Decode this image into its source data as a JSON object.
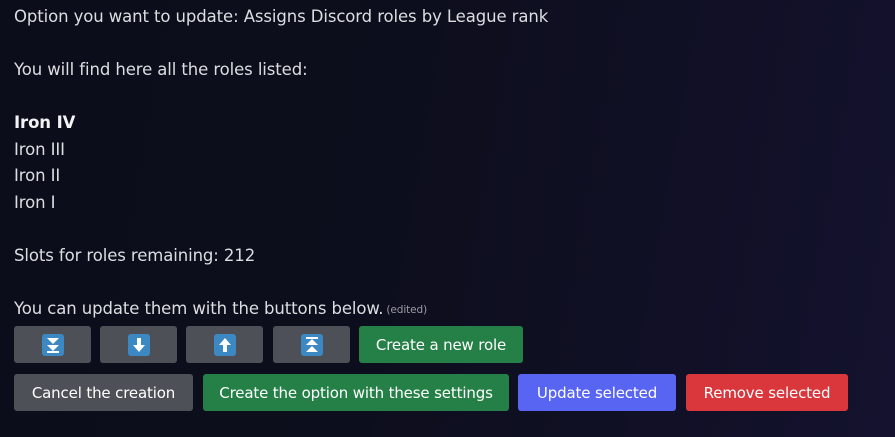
{
  "message": {
    "option_line": "Option you want to update: Assigns Discord roles by League rank",
    "intro_line": "You will find here all the roles listed:",
    "roles": [
      {
        "name": "Iron IV",
        "selected": true
      },
      {
        "name": "Iron III",
        "selected": false
      },
      {
        "name": "Iron II",
        "selected": false
      },
      {
        "name": "Iron I",
        "selected": false
      }
    ],
    "slots_line": "Slots for roles remaining: 212",
    "update_line": "You can update them with the buttons below.",
    "edited_label": "(edited)"
  },
  "buttons_row1": {
    "move_bottom_icon": "double-down-arrow-icon",
    "move_down_icon": "down-arrow-icon",
    "move_up_icon": "up-arrow-icon",
    "move_top_icon": "double-up-arrow-icon",
    "create_role_label": "Create a new role"
  },
  "buttons_row2": {
    "cancel_label": "Cancel the creation",
    "create_option_label": "Create the option with these settings",
    "update_selected_label": "Update selected",
    "remove_selected_label": "Remove selected"
  },
  "colors": {
    "secondary": "#4e5058",
    "success": "#248046",
    "primary": "#5865f2",
    "danger": "#da373c",
    "emoji_blue": "#3b88c3"
  }
}
